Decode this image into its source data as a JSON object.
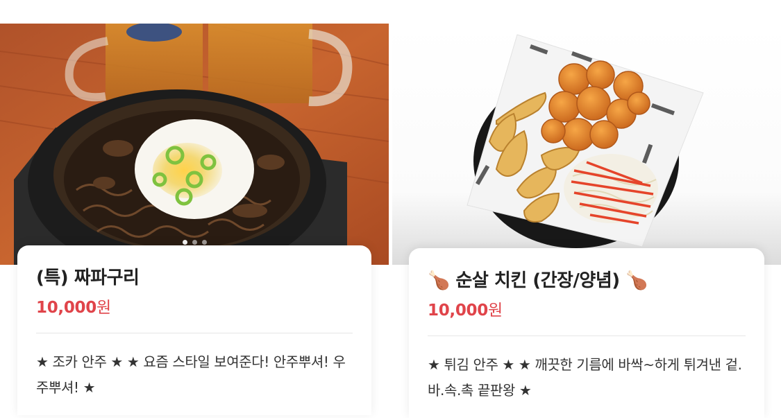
{
  "menu_items": [
    {
      "photo_alt": "짜파구리",
      "name": "(특) 짜파구리",
      "price_amount": "10,000",
      "price_unit": "원",
      "description": "★ 조카 안주 ★ ★ 요즘 스타일 보여준다! 안주뿌셔! 우주뿌셔! ★",
      "carousel": {
        "total": 3,
        "active": 1
      }
    },
    {
      "photo_alt": "순살 치킨",
      "name": "🍗 순살 치킨 (간장/양념) 🍗",
      "price_amount": "10,000",
      "price_unit": "원",
      "description": "★ 튀김 안주 ★ ★ 깨끗한 기름에 바싹~하게 튀겨낸 겉.바.속.촉 끝판왕 ★"
    }
  ],
  "colors": {
    "price": "#e0444a",
    "title": "#222222",
    "description": "#333333",
    "divider": "#e6e6e6"
  }
}
